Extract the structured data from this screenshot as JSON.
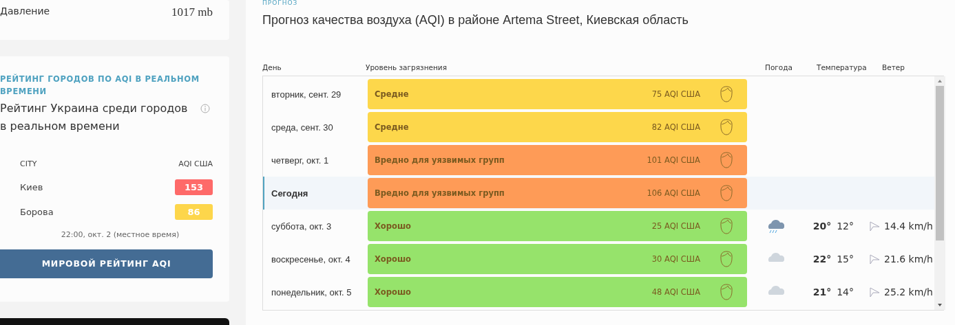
{
  "weather_card": {
    "label": "Давление",
    "value": "1017 mb"
  },
  "ranking_card": {
    "heading": "РЕЙТИНГ ГОРОДОВ ПО AQI В РЕАЛЬНОМ ВРЕМЕНИ",
    "title": "Рейтинг Украина среди городов в реальном времени",
    "columns": [
      "CITY",
      "AQI США"
    ],
    "rows": [
      {
        "city": "Киев",
        "aqi": "153",
        "color": "#fe6a69"
      },
      {
        "city": "Борова",
        "aqi": "86",
        "color": "#fdd64b"
      }
    ],
    "timestamp": "22:00, окт. 2 (местное время)",
    "button": "МИРОВОЙ РЕЙТИНГ AQI"
  },
  "forecast": {
    "section_label": "ПРОГНОЗ",
    "title": "Прогноз качества воздуха (AQI) в районе Artema Street, Киевская область",
    "columns": [
      "День",
      "Уровень загрязнения",
      "Погода",
      "Температура",
      "Ветер"
    ],
    "rows": [
      {
        "day": "вторник, сент. 29",
        "selected": false,
        "color": "#fdd74b",
        "status": "Средне",
        "aqi": "75 AQI США"
      },
      {
        "day": "среда, сент. 30",
        "selected": false,
        "color": "#fdd74b",
        "status": "Средне",
        "aqi": "82 AQI США"
      },
      {
        "day": "четверг, окт. 1",
        "selected": false,
        "color": "#fe9b57",
        "status": "Вредно для уязвимых групп",
        "aqi": "101 AQI США"
      },
      {
        "day": "Сегодня",
        "selected": true,
        "color": "#fe9b57",
        "status": "Вредно для уязвимых групп",
        "aqi": "106 AQI США"
      },
      {
        "day": "суббота, окт. 3",
        "selected": false,
        "color": "#96e36b",
        "status": "Хорошо",
        "aqi": "25 AQI США",
        "weather": {
          "kind": "rain"
        },
        "high": "20°",
        "low": "12°",
        "wind": "14.4 km/h"
      },
      {
        "day": "воскресенье, окт. 4",
        "selected": false,
        "color": "#96e36b",
        "status": "Хорошо",
        "aqi": "30 AQI США",
        "weather": {
          "kind": "cloud"
        },
        "high": "22°",
        "low": "15°",
        "wind": "21.6 km/h"
      },
      {
        "day": "понедельник, окт. 5",
        "selected": false,
        "color": "#96e36b",
        "status": "Хорошо",
        "aqi": "48 AQI США",
        "weather": {
          "kind": "cloud"
        },
        "high": "21°",
        "low": "14°",
        "wind": "25.2 km/h"
      }
    ]
  }
}
